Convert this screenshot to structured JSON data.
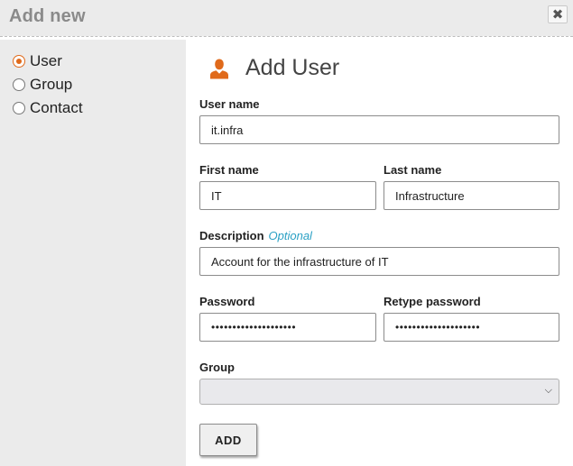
{
  "window": {
    "title": "Add new",
    "close_glyph": "✖"
  },
  "sidebar": {
    "options": [
      {
        "label": "User",
        "checked": true
      },
      {
        "label": "Group",
        "checked": false
      },
      {
        "label": "Contact",
        "checked": false
      }
    ]
  },
  "form": {
    "heading": "Add User",
    "heading_icon": "user-icon",
    "accent_color": "#e06a1b",
    "username": {
      "label": "User name",
      "value": "it.infra"
    },
    "first_name": {
      "label": "First name",
      "value": "IT"
    },
    "last_name": {
      "label": "Last name",
      "value": "Infrastructure"
    },
    "description": {
      "label": "Description",
      "optional": "Optional",
      "value": "Account for the infrastructure of IT"
    },
    "password": {
      "label": "Password",
      "value": "••••••••••••••••••••"
    },
    "retype_password": {
      "label": "Retype password",
      "value": "••••••••••••••••••••"
    },
    "group": {
      "label": "Group",
      "value": ""
    },
    "submit_label": "ADD"
  }
}
